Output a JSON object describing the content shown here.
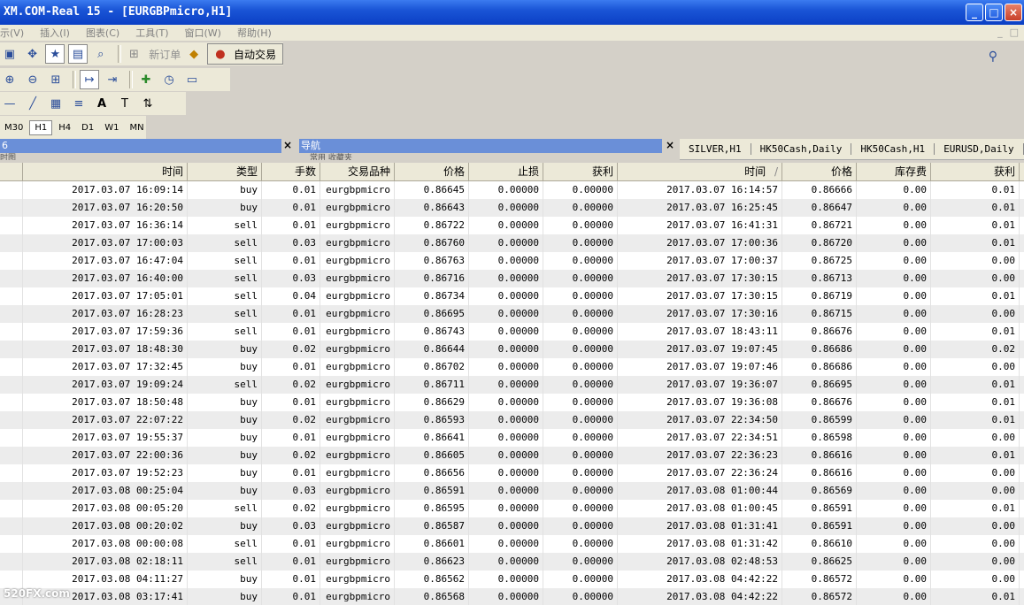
{
  "window": {
    "title": "XM.COM-Real 15 - [EURGBPmicro,H1]",
    "min_label": "_",
    "max_label": "□",
    "close_label": "×"
  },
  "menu": {
    "items": [
      "示(V)",
      "插入(I)",
      "图表(C)",
      "工具(T)",
      "窗口(W)",
      "帮助(H)"
    ],
    "right": [
      "_",
      "□"
    ]
  },
  "toolbar": {
    "new_order": "新订单",
    "auto_trade": "自动交易"
  },
  "periods": [
    "M30",
    "H1",
    "H4",
    "D1",
    "W1",
    "MN"
  ],
  "active_period": "H1",
  "panes": {
    "left_title": "6",
    "left_sub": "时图",
    "nav_title": "导航",
    "nav_sub": "常用    收藏夹",
    "close": "×"
  },
  "chart_tabs": [
    "SILVER,H1",
    "HK50Cash,Daily",
    "HK50Cash,H1",
    "EURUSD,Daily"
  ],
  "table": {
    "headers": [
      "",
      "时间",
      "类型",
      "手数",
      "交易品种",
      "价格",
      "止损",
      "获利",
      "时间",
      "价格",
      "库存费",
      "获利"
    ],
    "sort_mark": "/",
    "rows": [
      [
        "2017.03.07 16:09:14",
        "buy",
        "0.01",
        "eurgbpmicro",
        "0.86645",
        "0.00000",
        "0.00000",
        "2017.03.07 16:14:57",
        "0.86666",
        "0.00",
        "0.01"
      ],
      [
        "2017.03.07 16:20:50",
        "buy",
        "0.01",
        "eurgbpmicro",
        "0.86643",
        "0.00000",
        "0.00000",
        "2017.03.07 16:25:45",
        "0.86647",
        "0.00",
        "0.01"
      ],
      [
        "2017.03.07 16:36:14",
        "sell",
        "0.01",
        "eurgbpmicro",
        "0.86722",
        "0.00000",
        "0.00000",
        "2017.03.07 16:41:31",
        "0.86721",
        "0.00",
        "0.01"
      ],
      [
        "2017.03.07 17:00:03",
        "sell",
        "0.03",
        "eurgbpmicro",
        "0.86760",
        "0.00000",
        "0.00000",
        "2017.03.07 17:00:36",
        "0.86720",
        "0.00",
        "0.01"
      ],
      [
        "2017.03.07 16:47:04",
        "sell",
        "0.01",
        "eurgbpmicro",
        "0.86763",
        "0.00000",
        "0.00000",
        "2017.03.07 17:00:37",
        "0.86725",
        "0.00",
        "0.00"
      ],
      [
        "2017.03.07 16:40:00",
        "sell",
        "0.03",
        "eurgbpmicro",
        "0.86716",
        "0.00000",
        "0.00000",
        "2017.03.07 17:30:15",
        "0.86713",
        "0.00",
        "0.00"
      ],
      [
        "2017.03.07 17:05:01",
        "sell",
        "0.04",
        "eurgbpmicro",
        "0.86734",
        "0.00000",
        "0.00000",
        "2017.03.07 17:30:15",
        "0.86719",
        "0.00",
        "0.01"
      ],
      [
        "2017.03.07 16:28:23",
        "sell",
        "0.01",
        "eurgbpmicro",
        "0.86695",
        "0.00000",
        "0.00000",
        "2017.03.07 17:30:16",
        "0.86715",
        "0.00",
        "0.00"
      ],
      [
        "2017.03.07 17:59:36",
        "sell",
        "0.01",
        "eurgbpmicro",
        "0.86743",
        "0.00000",
        "0.00000",
        "2017.03.07 18:43:11",
        "0.86676",
        "0.00",
        "0.01"
      ],
      [
        "2017.03.07 18:48:30",
        "buy",
        "0.02",
        "eurgbpmicro",
        "0.86644",
        "0.00000",
        "0.00000",
        "2017.03.07 19:07:45",
        "0.86686",
        "0.00",
        "0.02"
      ],
      [
        "2017.03.07 17:32:45",
        "buy",
        "0.01",
        "eurgbpmicro",
        "0.86702",
        "0.00000",
        "0.00000",
        "2017.03.07 19:07:46",
        "0.86686",
        "0.00",
        "0.00"
      ],
      [
        "2017.03.07 19:09:24",
        "sell",
        "0.02",
        "eurgbpmicro",
        "0.86711",
        "0.00000",
        "0.00000",
        "2017.03.07 19:36:07",
        "0.86695",
        "0.00",
        "0.01"
      ],
      [
        "2017.03.07 18:50:48",
        "buy",
        "0.01",
        "eurgbpmicro",
        "0.86629",
        "0.00000",
        "0.00000",
        "2017.03.07 19:36:08",
        "0.86676",
        "0.00",
        "0.01"
      ],
      [
        "2017.03.07 22:07:22",
        "buy",
        "0.02",
        "eurgbpmicro",
        "0.86593",
        "0.00000",
        "0.00000",
        "2017.03.07 22:34:50",
        "0.86599",
        "0.00",
        "0.01"
      ],
      [
        "2017.03.07 19:55:37",
        "buy",
        "0.01",
        "eurgbpmicro",
        "0.86641",
        "0.00000",
        "0.00000",
        "2017.03.07 22:34:51",
        "0.86598",
        "0.00",
        "0.00"
      ],
      [
        "2017.03.07 22:00:36",
        "buy",
        "0.02",
        "eurgbpmicro",
        "0.86605",
        "0.00000",
        "0.00000",
        "2017.03.07 22:36:23",
        "0.86616",
        "0.00",
        "0.01"
      ],
      [
        "2017.03.07 19:52:23",
        "buy",
        "0.01",
        "eurgbpmicro",
        "0.86656",
        "0.00000",
        "0.00000",
        "2017.03.07 22:36:24",
        "0.86616",
        "0.00",
        "0.00"
      ],
      [
        "2017.03.08 00:25:04",
        "buy",
        "0.03",
        "eurgbpmicro",
        "0.86591",
        "0.00000",
        "0.00000",
        "2017.03.08 01:00:44",
        "0.86569",
        "0.00",
        "0.00"
      ],
      [
        "2017.03.08 00:05:20",
        "sell",
        "0.02",
        "eurgbpmicro",
        "0.86595",
        "0.00000",
        "0.00000",
        "2017.03.08 01:00:45",
        "0.86591",
        "0.00",
        "0.01"
      ],
      [
        "2017.03.08 00:20:02",
        "buy",
        "0.03",
        "eurgbpmicro",
        "0.86587",
        "0.00000",
        "0.00000",
        "2017.03.08 01:31:41",
        "0.86591",
        "0.00",
        "0.00"
      ],
      [
        "2017.03.08 00:00:08",
        "sell",
        "0.01",
        "eurgbpmicro",
        "0.86601",
        "0.00000",
        "0.00000",
        "2017.03.08 01:31:42",
        "0.86610",
        "0.00",
        "0.00"
      ],
      [
        "2017.03.08 02:18:11",
        "sell",
        "0.01",
        "eurgbpmicro",
        "0.86623",
        "0.00000",
        "0.00000",
        "2017.03.08 02:48:53",
        "0.86625",
        "0.00",
        "0.00"
      ],
      [
        "2017.03.08 04:11:27",
        "buy",
        "0.01",
        "eurgbpmicro",
        "0.86562",
        "0.00000",
        "0.00000",
        "2017.03.08 04:42:22",
        "0.86572",
        "0.00",
        "0.00"
      ],
      [
        "2017.03.08 03:17:41",
        "buy",
        "0.01",
        "eurgbpmicro",
        "0.86568",
        "0.00000",
        "0.00000",
        "2017.03.08 04:42:22",
        "0.86572",
        "0.00",
        "0.01"
      ]
    ]
  },
  "watermark": "520FX.com"
}
